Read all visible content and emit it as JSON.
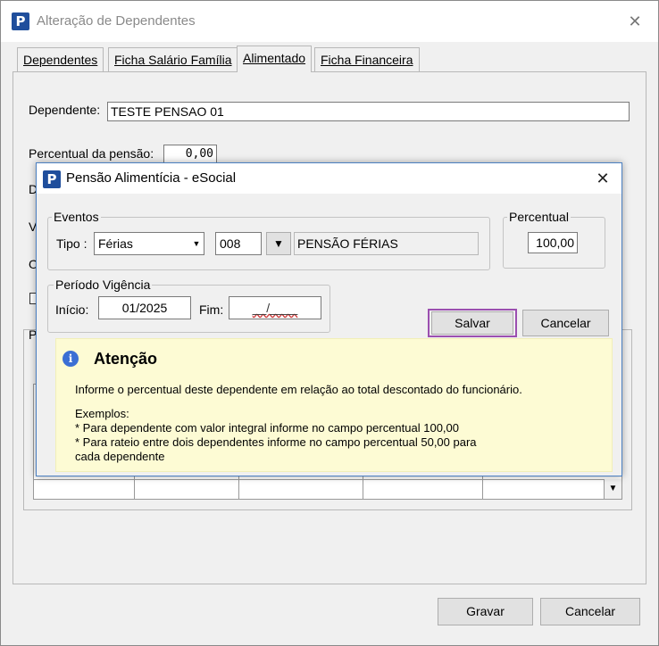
{
  "outer": {
    "title": "Alteração de Dependentes",
    "close_glyph": "✕",
    "tabs": [
      {
        "label": "Dependentes"
      },
      {
        "label": "Ficha Salário Família"
      },
      {
        "label": "Alimentado"
      },
      {
        "label": "Ficha Financeira"
      }
    ],
    "dependente_label": "Dependente:",
    "dependente_value": "TESTE PENSAO 01",
    "percentual_label": "Percentual da pensão:",
    "percentual_value": "0,00",
    "hidden_label_d": "D",
    "hidden_label_v": "V",
    "hidden_label_o": "O",
    "hidden_label_p": "P",
    "gravar_label": "Gravar",
    "cancelar_label": "Cancelar"
  },
  "modal": {
    "title": "Pensão Alimentícia - eSocial",
    "close_glyph": "✕",
    "eventos_legend": "Eventos",
    "tipo_label": "Tipo :",
    "tipo_value": "Férias",
    "codigo_value": "008",
    "evento_desc": "PENSÃO FÉRIAS",
    "percentual_legend": "Percentual",
    "percentual_value": "100,00",
    "periodo_legend": "Período Vigência",
    "inicio_label": "Início:",
    "inicio_value": "01/2025",
    "fim_label": "Fim:",
    "fim_value": "__/____",
    "salvar_label": "Salvar",
    "cancelar_label": "Cancelar",
    "highlight_color": "#9b4fb0",
    "attention": {
      "title": "Atenção",
      "text": "Informe o percentual deste dependente em relação ao total descontado do funcionário.",
      "examples_title": "Exemplos:",
      "example1": "* Para dependente com valor integral informe no campo percentual 100,00",
      "example2": "* Para rateio entre dois dependentes informe no campo percentual 50,00 para",
      "example2_cont": "cada dependente"
    }
  },
  "icons": {
    "app_icon": "app-logo-icon",
    "info_icon": "info-icon",
    "dropdown_icon": "chevron-down-icon"
  }
}
